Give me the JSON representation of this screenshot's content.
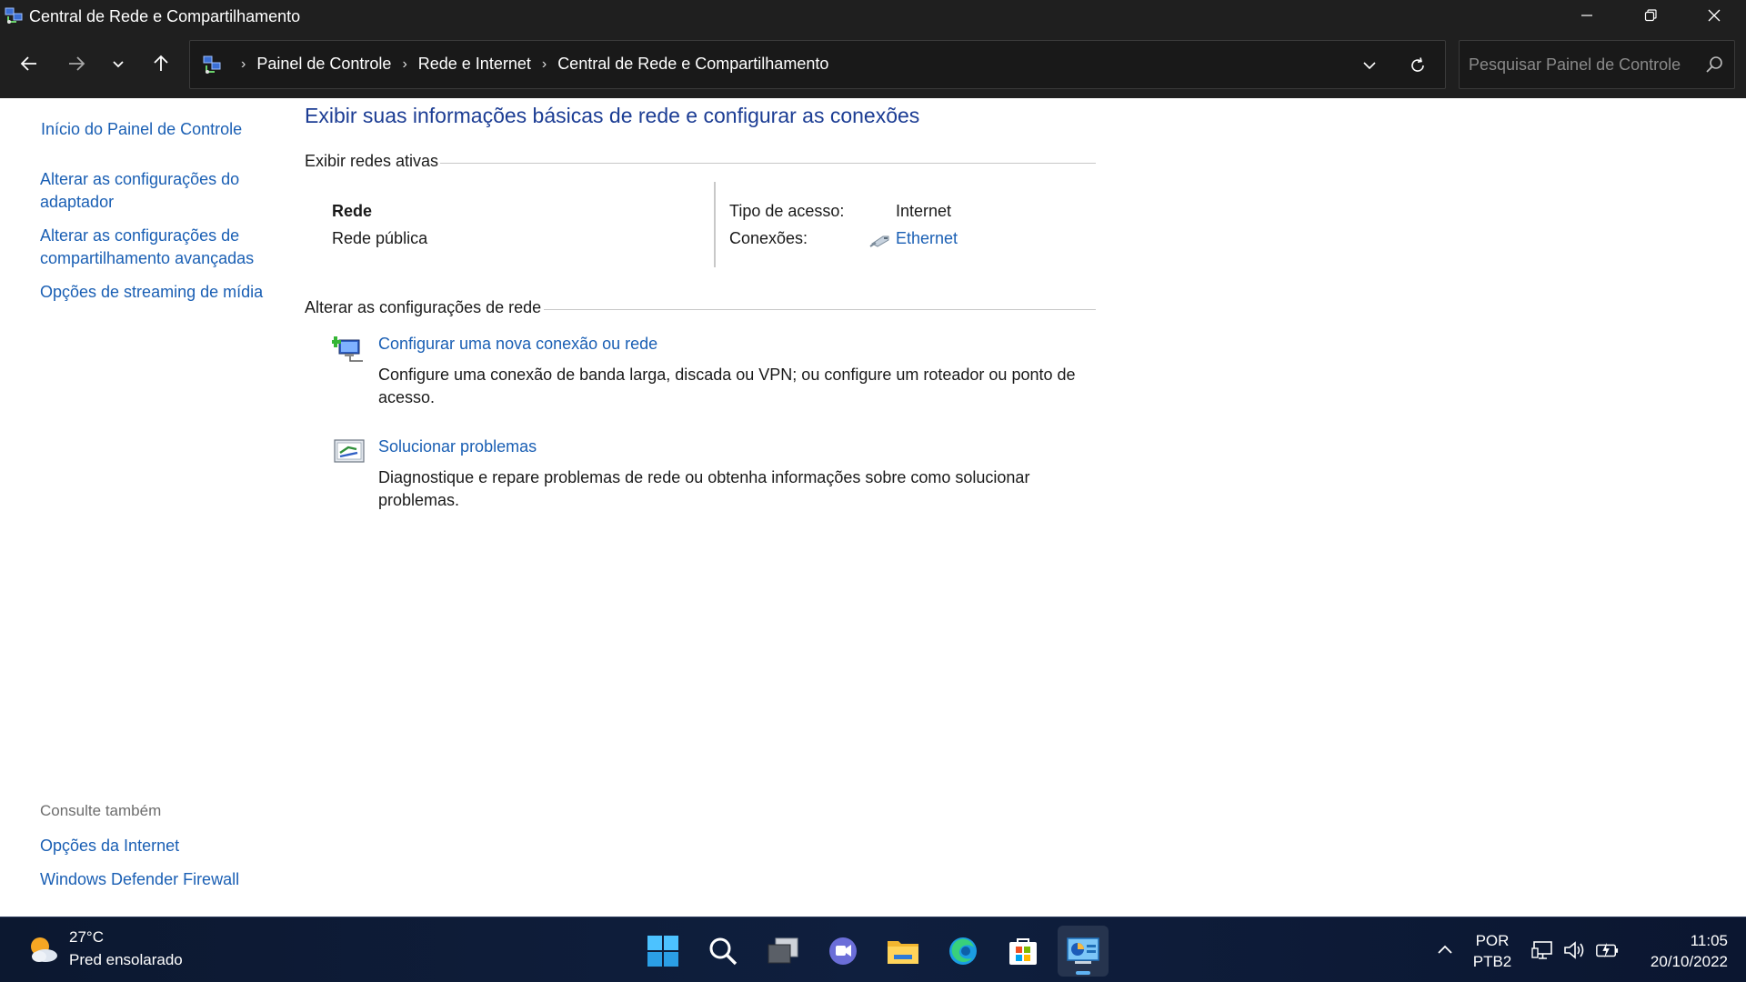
{
  "window": {
    "title": "Central de Rede e Compartilhamento"
  },
  "address": {
    "crumbs": [
      "Painel de Controle",
      "Rede e Internet",
      "Central de Rede e Compartilhamento"
    ],
    "search_placeholder": "Pesquisar Painel de Controle"
  },
  "sidebar": {
    "home_link": "Início do Painel de Controle",
    "links": [
      "Alterar as configurações do adaptador",
      "Alterar as configurações de compartilhamento avançadas",
      "Opções de streaming de mídia"
    ],
    "see_also_heading": "Consulte também",
    "see_also": [
      "Opções da Internet",
      "Windows Defender Firewall"
    ]
  },
  "main": {
    "title": "Exibir suas informações básicas de rede e configurar as conexões",
    "active_networks_heading": "Exibir redes ativas",
    "network": {
      "name": "Rede",
      "category": "Rede pública",
      "access_type_label": "Tipo de acesso:",
      "access_type_value": "Internet",
      "connections_label": "Conexões:",
      "connection_link": "Ethernet"
    },
    "change_settings_heading": "Alterar as configurações de rede",
    "tasks": [
      {
        "link": "Configurar uma nova conexão ou rede",
        "description": "Configure uma conexão de banda larga, discada ou VPN; ou configure um roteador ou ponto de acesso."
      },
      {
        "link": "Solucionar problemas",
        "description": "Diagnostique e repare problemas de rede ou obtenha informações sobre como solucionar problemas."
      }
    ]
  },
  "taskbar": {
    "weather_temp": "27°C",
    "weather_desc": "Pred ensolarado",
    "apps": [
      "start-icon",
      "search-icon",
      "task-view-icon",
      "chat-icon",
      "file-explorer-icon",
      "edge-icon",
      "store-icon",
      "control-panel-icon"
    ],
    "language_line1": "POR",
    "language_line2": "PTB2",
    "time": "11:05",
    "date": "20/10/2022"
  },
  "colors": {
    "link": "#1a5fb4",
    "title": "#1c3d94",
    "chrome": "#1f1f1f"
  }
}
